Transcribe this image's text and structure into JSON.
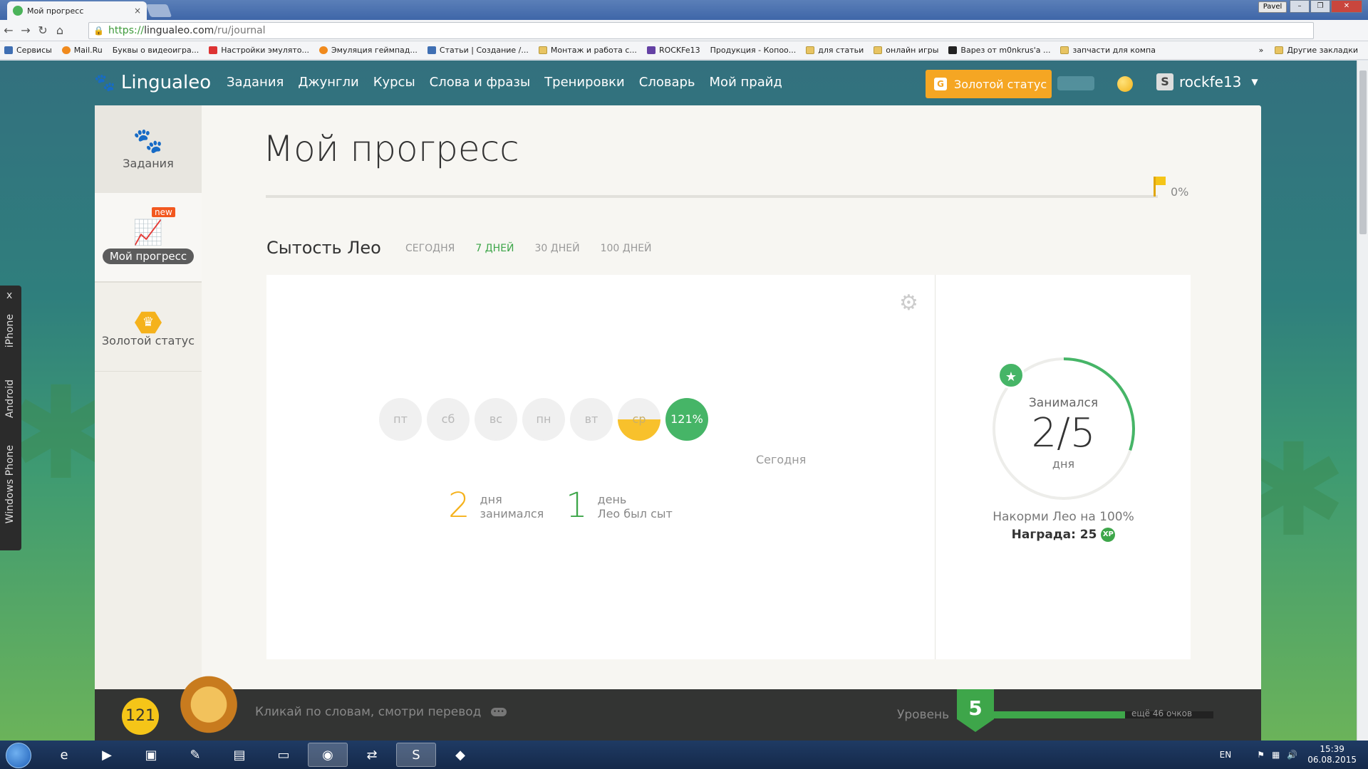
{
  "browser": {
    "tab_title": "Мой прогресс",
    "tab_close": "×",
    "user_button": "Pavel",
    "url_scheme": "https://",
    "url_host": "lingualeo.com",
    "url_path": "/ru/journal",
    "bookmarks": [
      {
        "label": "Сервисы",
        "icon": "apps"
      },
      {
        "label": "Mail.Ru",
        "icon": "mailru"
      },
      {
        "label": "Буквы о видеоигра...",
        "icon": "page"
      },
      {
        "label": "Настройки эмулято...",
        "icon": "red"
      },
      {
        "label": "Эмуляция геймпад...",
        "icon": "orange"
      },
      {
        "label": "Статьи | Создание /...",
        "icon": "vk"
      },
      {
        "label": "Монтаж и работа с...",
        "icon": "folder"
      },
      {
        "label": "ROCKFe13",
        "icon": "twitch"
      },
      {
        "label": "Продукция - Копоо...",
        "icon": "page"
      },
      {
        "label": "для статьи",
        "icon": "folder"
      },
      {
        "label": "онлайн игры",
        "icon": "folder"
      },
      {
        "label": "Варез от m0nkrus'a ...",
        "icon": "dark"
      },
      {
        "label": "запчасти для компа",
        "icon": "folder"
      }
    ],
    "bookmarks_more": "»",
    "other_bookmarks": "Другие закладки"
  },
  "site": {
    "logo_text": "Lingualeo",
    "nav": [
      "Задания",
      "Джунгли",
      "Курсы",
      "Слова и фразы",
      "Тренировки",
      "Словарь",
      "Мой прайд"
    ],
    "gold_button_badge": "G",
    "gold_button": "Золотой статус",
    "username": "rockfe13",
    "avatar_letter": "S"
  },
  "sidebar": {
    "items": [
      {
        "label": "Задания",
        "icon": "paw-icon"
      },
      {
        "label": "Мой прогресс",
        "icon": "chart-icon",
        "badge": "new"
      },
      {
        "label": "Золотой статус",
        "icon": "crown-icon"
      }
    ]
  },
  "main": {
    "title": "Мой прогресс",
    "progress_pct": "0%",
    "section_title": "Сытость Лео",
    "ranges": [
      "СЕГОДНЯ",
      "7 ДНЕЙ",
      "30 ДНЕЙ",
      "100 ДНЕЙ"
    ],
    "active_range": "7 ДНЕЙ",
    "days": [
      {
        "label": "пт",
        "fill": 0
      },
      {
        "label": "сб",
        "fill": 0
      },
      {
        "label": "вс",
        "fill": 0
      },
      {
        "label": "пн",
        "fill": 0
      },
      {
        "label": "вт",
        "fill": 0
      },
      {
        "label": "ср",
        "fill": 0.5
      },
      {
        "label": "121%",
        "fill": 1
      }
    ],
    "today_label": "Сегодня",
    "stat1": {
      "num": "2",
      "line1": "дня",
      "line2": "занимался",
      "color": "#f5b21c"
    },
    "stat2": {
      "num": "1",
      "line1": "день",
      "line2": "Лео был сыт",
      "color": "#3ea64a"
    }
  },
  "goal": {
    "label_top": "Занимался",
    "value": "2/5",
    "label_bottom": "дня",
    "progress": 0.4,
    "feed_text": "Накорми Лео на 100%",
    "reward_label": "Награда: 25",
    "xp_badge": "XP"
  },
  "bottom": {
    "score": "121",
    "hint": "Кликай по словам, смотри перевод",
    "hint_dots": "•••",
    "level_label": "Уровень",
    "level": "5",
    "more_points": "ещё 46 очков",
    "level_progress": 0.6
  },
  "side_strip": {
    "close": "x",
    "labels": [
      "iPhone",
      "Android",
      "Windows Phone"
    ]
  },
  "taskbar": {
    "lang": "EN",
    "time": "15:39",
    "date": "06.08.2015"
  },
  "colors": {
    "accent_green": "#3ea64a",
    "gold": "#f5a623",
    "page_teal": "#33707e"
  }
}
